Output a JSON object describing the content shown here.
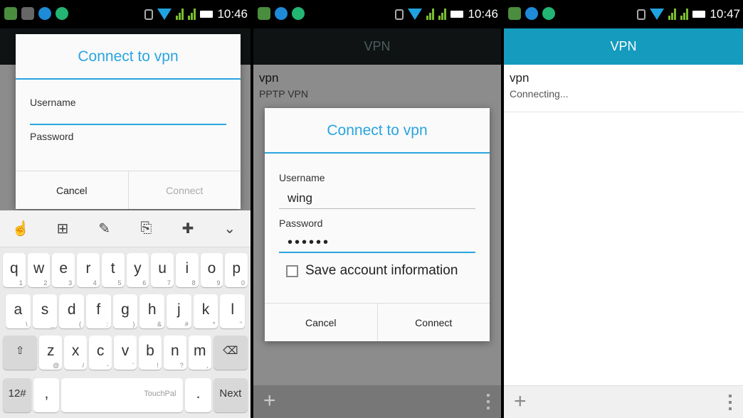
{
  "panel1": {
    "time": "10:46",
    "dialog": {
      "title": "Connect to vpn",
      "username_label": "Username",
      "password_label": "Password",
      "cancel": "Cancel",
      "connect": "Connect"
    },
    "keyboard": {
      "row1": [
        {
          "k": "q",
          "s": "1"
        },
        {
          "k": "w",
          "s": "2"
        },
        {
          "k": "e",
          "s": "3"
        },
        {
          "k": "r",
          "s": "4"
        },
        {
          "k": "t",
          "s": "5"
        },
        {
          "k": "y",
          "s": "6"
        },
        {
          "k": "u",
          "s": "7"
        },
        {
          "k": "i",
          "s": "8"
        },
        {
          "k": "o",
          "s": "9"
        },
        {
          "k": "p",
          "s": "0"
        }
      ],
      "row2": [
        {
          "k": "a",
          "s": "\\"
        },
        {
          "k": "s",
          "s": "_"
        },
        {
          "k": "d",
          "s": "("
        },
        {
          "k": "f",
          "s": ":"
        },
        {
          "k": "g",
          "s": ")"
        },
        {
          "k": "h",
          "s": "&"
        },
        {
          "k": "j",
          "s": "#"
        },
        {
          "k": "k",
          "s": "*"
        },
        {
          "k": "l",
          "s": "\""
        }
      ],
      "row3": [
        {
          "k": "z",
          "s": "@"
        },
        {
          "k": "x",
          "s": "/"
        },
        {
          "k": "c",
          "s": "-"
        },
        {
          "k": "v",
          "s": "'"
        },
        {
          "k": "b",
          "s": "!"
        },
        {
          "k": "n",
          "s": "?"
        },
        {
          "k": "m",
          "s": ","
        }
      ],
      "sym_key": "12#",
      "comma_key": ",",
      "space_label": "TouchPal",
      "period_key": ".",
      "next_key": "Next"
    }
  },
  "panel2": {
    "time": "10:46",
    "appbar_title": "VPN",
    "vpn_name": "vpn",
    "vpn_type": "PPTP VPN",
    "dialog": {
      "title": "Connect to vpn",
      "username_label": "Username",
      "username_value": "wing",
      "password_label": "Password",
      "password_value": "••••••",
      "save_label": "Save account information",
      "cancel": "Cancel",
      "connect": "Connect"
    }
  },
  "panel3": {
    "time": "10:47",
    "appbar_title": "VPN",
    "vpn_name": "vpn",
    "vpn_status": "Connecting..."
  },
  "colors": {
    "accent": "#29a5df",
    "appbar_dark": "#1d2326",
    "appbar_teal": "#149bbe"
  }
}
